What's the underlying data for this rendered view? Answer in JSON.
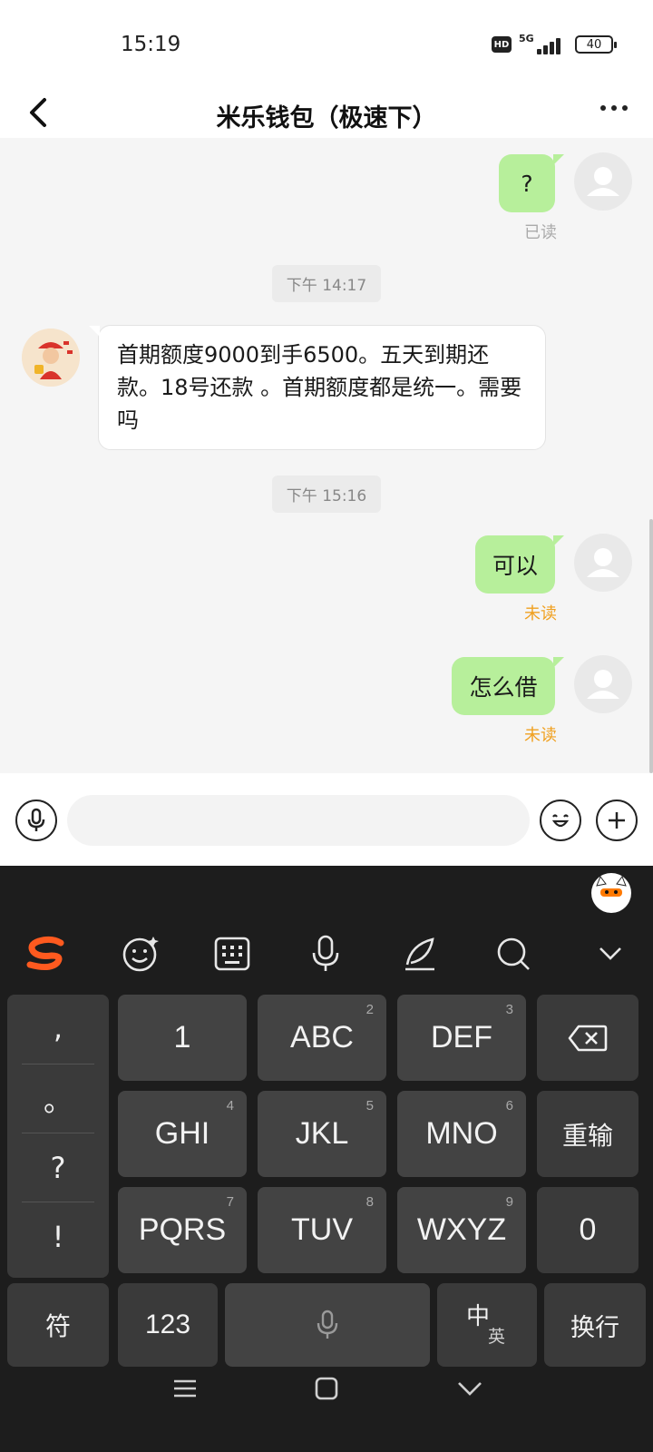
{
  "status_bar": {
    "time": "15:19",
    "hd": "HD",
    "network": "5G",
    "battery": "40"
  },
  "header": {
    "title": "米乐钱包（极速下）"
  },
  "messages": {
    "outgoing_1": {
      "text": "?",
      "status": "已读"
    },
    "timestamp_1": "下午 14:17",
    "incoming_1": {
      "text": "首期额度9000到手6500。五天到期还款。18号还款 。首期额度都是统一。需要吗"
    },
    "timestamp_2": "下午 15:16",
    "outgoing_2": {
      "text": "可以",
      "status": "未读"
    },
    "outgoing_3": {
      "text": "怎么借",
      "status": "未读"
    }
  },
  "colors": {
    "bubble_out": "#b7ef9b",
    "read_status": "#aaaaaa",
    "unread_status": "#f0a020",
    "keyboard_bg": "#1d1d1d",
    "brand_orange": "#ff5a1f"
  },
  "input": {
    "value": "",
    "placeholder": ""
  },
  "keyboard": {
    "punctuation": [
      ",",
      "。",
      "?",
      "!"
    ],
    "rows": [
      [
        {
          "label": "1",
          "sub": ""
        },
        {
          "label": "ABC",
          "sub": "2"
        },
        {
          "label": "DEF",
          "sub": "3"
        }
      ],
      [
        {
          "label": "GHI",
          "sub": "4"
        },
        {
          "label": "JKL",
          "sub": "5"
        },
        {
          "label": "MNO",
          "sub": "6"
        }
      ],
      [
        {
          "label": "PQRS",
          "sub": "7"
        },
        {
          "label": "TUV",
          "sub": "8"
        },
        {
          "label": "WXYZ",
          "sub": "9"
        }
      ]
    ],
    "retype": "重输",
    "zero": "0",
    "symbol": "符",
    "num": "123",
    "lang_main": "中",
    "lang_sub": "英",
    "enter": "换行"
  }
}
